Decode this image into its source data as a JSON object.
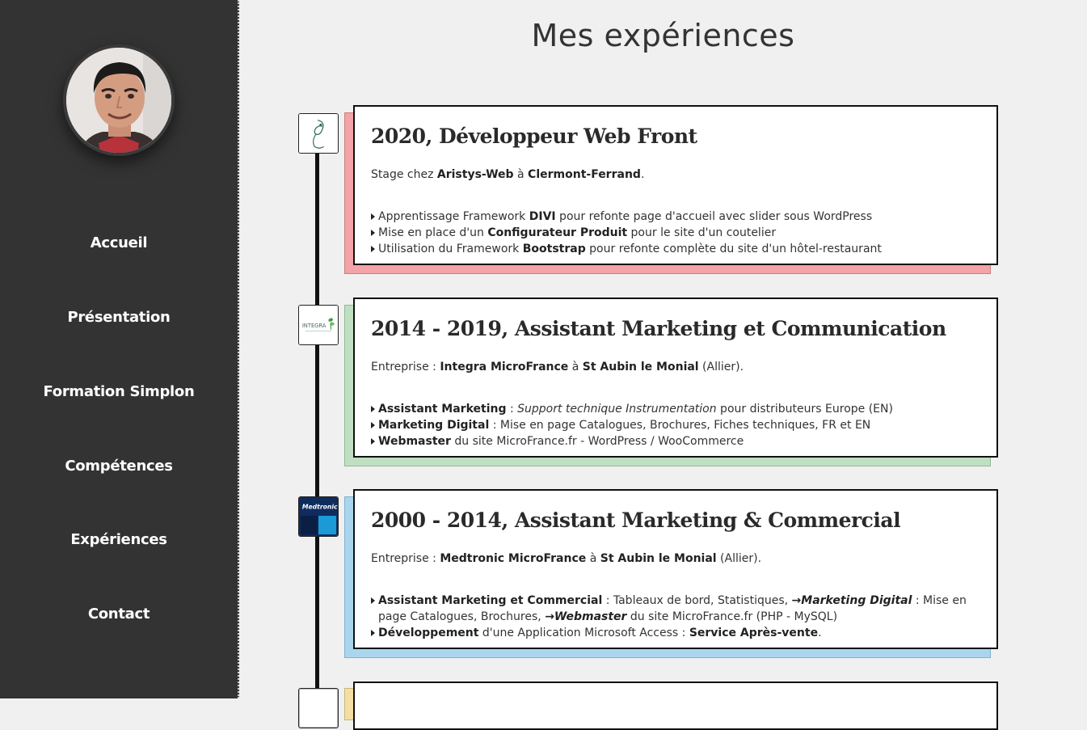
{
  "sidebar": {
    "nav": [
      {
        "label": "Accueil"
      },
      {
        "label": "Présentation"
      },
      {
        "label": "Formation Simplon"
      },
      {
        "label": "Compétences"
      },
      {
        "label": "Expériences"
      },
      {
        "label": "Contact"
      }
    ]
  },
  "page": {
    "title": "Mes expériences"
  },
  "logos": {
    "integra": "INTEGRA",
    "medtronic": "Medtronic"
  },
  "colors": {
    "red": "#f4a3a6",
    "green": "#bfe0c0",
    "blue": "#a9d6ee"
  },
  "experiences": [
    {
      "title": "2020, Développeur Web Front",
      "intro": {
        "a": "Stage chez ",
        "b1": "Aristys-Web",
        "c": " à ",
        "b2": "Clermont-Ferrand",
        "d": "."
      },
      "bullets": [
        {
          "a": "Apprentissage Framework ",
          "b": "DIVI",
          "c": " pour refonte page d'accueil avec slider sous WordPress"
        },
        {
          "a": "Mise en place d'un ",
          "b": "Configurateur Produit",
          "c": " pour le site d'un coutelier"
        },
        {
          "a": "Utilisation du Framework ",
          "b": "Bootstrap",
          "c": " pour refonte complète du site d'un hôtel-restaurant"
        }
      ]
    },
    {
      "title": "2014 - 2019, Assistant Marketing et Communication",
      "intro": {
        "a": "Entreprise : ",
        "b1": "Integra MicroFrance",
        "c": " à ",
        "b2": "St Aubin le Monial",
        "d": " (Allier)."
      },
      "bullets": [
        {
          "b": "Assistant Marketing",
          "a": " : ",
          "i": "Support technique Instrumentation",
          "c": " pour distributeurs Europe (EN)"
        },
        {
          "b": "Marketing Digital",
          "c": " : Mise en page Catalogues, Brochures, Fiches techniques, FR et EN"
        },
        {
          "b": "Webmaster",
          "c": " du site MicroFrance.fr - WordPress / WooCommerce"
        }
      ]
    },
    {
      "title": "2000 - 2014, Assistant Marketing & Commercial",
      "intro": {
        "a": "Entreprise : ",
        "b1": "Medtronic MicroFrance",
        "c": " à ",
        "b2": "St Aubin le Monial",
        "d": " (Allier)."
      },
      "bullets": [
        {
          "b": "Assistant Marketing et Commercial",
          "c": " : Tableaux de bord, Statistiques, ",
          "arrow1": "→",
          "i1": "Marketing Digital",
          "c2": " : Mise en page Catalogues, Brochures, ",
          "arrow2": "→",
          "i2": "Webmaster",
          "c3": " du site MicroFrance.fr (PHP - MySQL)"
        },
        {
          "b": "Développement",
          "c": " d'une Application Microsoft Access : ",
          "b2": "Service Après-vente",
          "d": "."
        }
      ]
    }
  ]
}
